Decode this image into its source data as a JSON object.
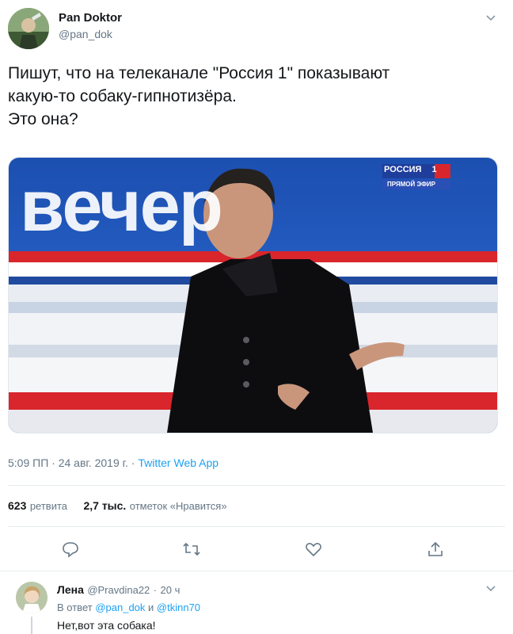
{
  "tweet": {
    "author_name": "Pan Doktor",
    "author_handle": "@pan_dok",
    "text_line1": "Пишут, что на телеканале \"Россия 1\" показывают",
    "text_line2": "какую-то собаку-гипнотизёра.",
    "text_line3": "Это она?",
    "media": {
      "banner_text": "вечер",
      "channel_logo": "РОССИЯ",
      "channel_number": "1",
      "live_label": "ПРЯМОЙ ЭФИР"
    },
    "time": "5:09 ПП",
    "date": "24 авг. 2019 г.",
    "separator": "·",
    "source": "Twitter Web App",
    "retweets_count": "623",
    "retweets_label": "ретвита",
    "likes_count": "2,7 тыс.",
    "likes_label": "отметок «Нравится»"
  },
  "actions": {
    "reply_icon": "reply-icon",
    "retweet_icon": "retweet-icon",
    "like_icon": "like-icon",
    "share_icon": "share-icon"
  },
  "reply": {
    "author_name": "Лена",
    "author_handle": "@Pravdina22",
    "separator": "·",
    "time": "20 ч",
    "reply_prefix": "В ответ",
    "mention1": "@pan_dok",
    "conj": "и",
    "mention2": "@tkinn70",
    "text": "Нет,вот эта собака!"
  },
  "colors": {
    "link": "#1da1f2",
    "secondary_text": "#657786",
    "primary_text": "#14171a"
  }
}
